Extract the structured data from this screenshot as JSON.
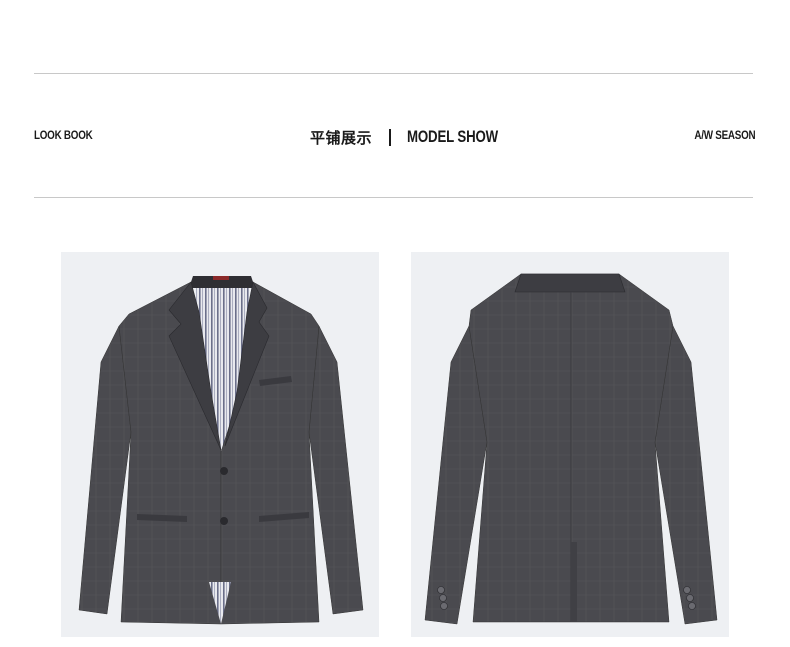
{
  "header": {
    "left_label": "LOOK BOOK",
    "center_cn": "平铺展示",
    "center_en": "MODEL SHOW",
    "right_label": "A/W SEASON"
  },
  "colors": {
    "panel_bg": "#eef0f3",
    "jacket": "#4a4a4f",
    "jacket_shadow": "#38383c",
    "lining_stripe": "#6b6f8a",
    "rule": "#c8c8c8"
  },
  "images": {
    "front": "grey-blazer-front",
    "back": "grey-blazer-back"
  }
}
